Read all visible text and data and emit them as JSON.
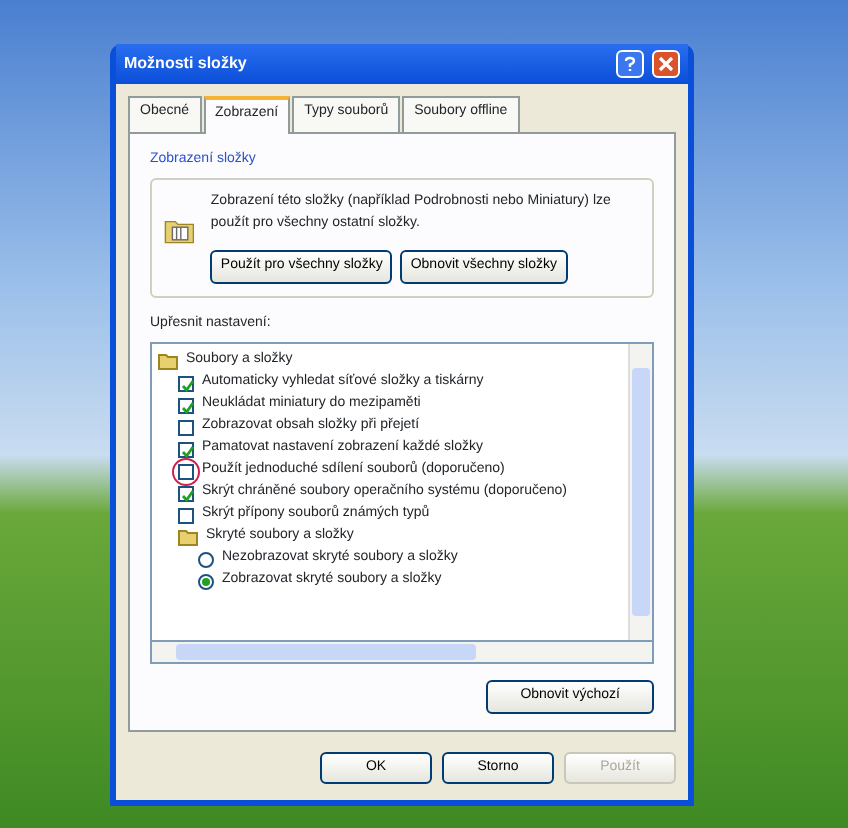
{
  "window": {
    "title": "Možnosti složky"
  },
  "tabs": [
    {
      "label": "Obecné",
      "selected": false
    },
    {
      "label": "Zobrazení",
      "selected": true
    },
    {
      "label": "Typy souborů",
      "selected": false
    },
    {
      "label": "Soubory offline",
      "selected": false
    }
  ],
  "folder_views": {
    "title": "Zobrazení složky",
    "text": "Zobrazení této složky (například Podrobnosti nebo Miniatury) lze použít pro všechny ostatní složky.",
    "buttons": [
      "Použít pro všechny složky",
      "Obnovit všechny složky"
    ]
  },
  "advanced": {
    "label": "Upřesnit nastavení:",
    "tree": [
      {
        "kind": "folder",
        "label": "Soubory a složky",
        "children": [
          {
            "kind": "checkbox",
            "label": "Automaticky vyhledat síťové složky a tiskárny",
            "checked": true,
            "highlighted": false
          },
          {
            "kind": "checkbox",
            "label": "Neukládat miniatury do mezipaměti",
            "checked": true,
            "highlighted": false
          },
          {
            "kind": "checkbox",
            "label": "Zobrazovat obsah složky při přejetí",
            "checked": false,
            "highlighted": false
          },
          {
            "kind": "checkbox",
            "label": "Pamatovat nastavení zobrazení každé složky",
            "checked": true,
            "highlighted": false
          },
          {
            "kind": "checkbox",
            "label": "Použít jednoduché sdílení souborů (doporučeno)",
            "checked": false,
            "highlighted": true
          },
          {
            "kind": "checkbox",
            "label": "Skrýt chráněné soubory operačního systému (doporučeno)",
            "checked": true,
            "highlighted": false
          },
          {
            "kind": "checkbox",
            "label": "Skrýt přípony souborů známých typů",
            "checked": false,
            "highlighted": false
          },
          {
            "kind": "folder",
            "label": "Skryté soubory a složky",
            "children": [
              {
                "kind": "radio",
                "label": "Nezobrazovat skryté soubory a složky",
                "selected": false
              },
              {
                "kind": "radio",
                "label": "Zobrazovat skryté soubory a složky",
                "selected": true
              }
            ]
          }
        ]
      }
    ],
    "restore_button": "Obnovit výchozí"
  },
  "buttons": [
    {
      "label": "OK",
      "disabled": false
    },
    {
      "label": "Storno",
      "disabled": false
    },
    {
      "label": "Použít",
      "disabled": true
    }
  ]
}
